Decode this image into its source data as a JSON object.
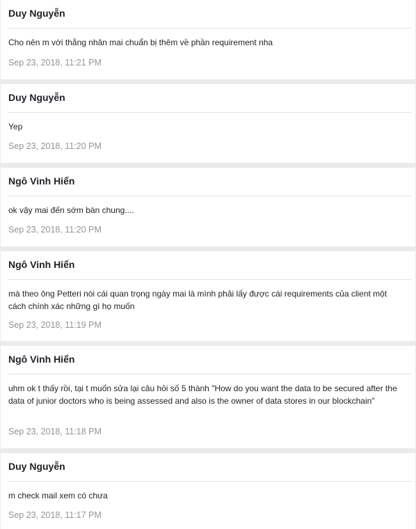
{
  "messages": [
    {
      "sender": "Duy Nguyễn",
      "text": "Cho nên m với thằng nhân mai chuẩn bị thêm về phần requirement nha",
      "time": "Sep 23, 2018, 11:21 PM"
    },
    {
      "sender": "Duy Nguyễn",
      "text": "Yep",
      "time": "Sep 23, 2018, 11:20 PM"
    },
    {
      "sender": "Ngô Vinh Hiển",
      "text": "ok vậy mai đến sớm bàn chung....",
      "time": "Sep 23, 2018, 11:20 PM"
    },
    {
      "sender": "Ngô Vinh Hiển",
      "text": "mà theo ông Petteri nói cái quan trọng ngày mai là mình phải lấy được cái requirements của client một cách chính xác những gì họ muốn",
      "time": "Sep 23, 2018, 11:19 PM"
    },
    {
      "sender": "Ngô Vinh Hiển",
      "text": "uhm ok t thấy rồi, tại t muốn sửa lại câu hỏi số 5 thành \"How do you want the data to be secured after the data of junior doctors who is being assessed and also is the owner of data stores in our blockchain\"",
      "time": "Sep 23, 2018, 11:18 PM"
    },
    {
      "sender": "Duy Nguyễn",
      "text": "m check mail xem có chưa",
      "time": "Sep 23, 2018, 11:17 PM"
    }
  ]
}
